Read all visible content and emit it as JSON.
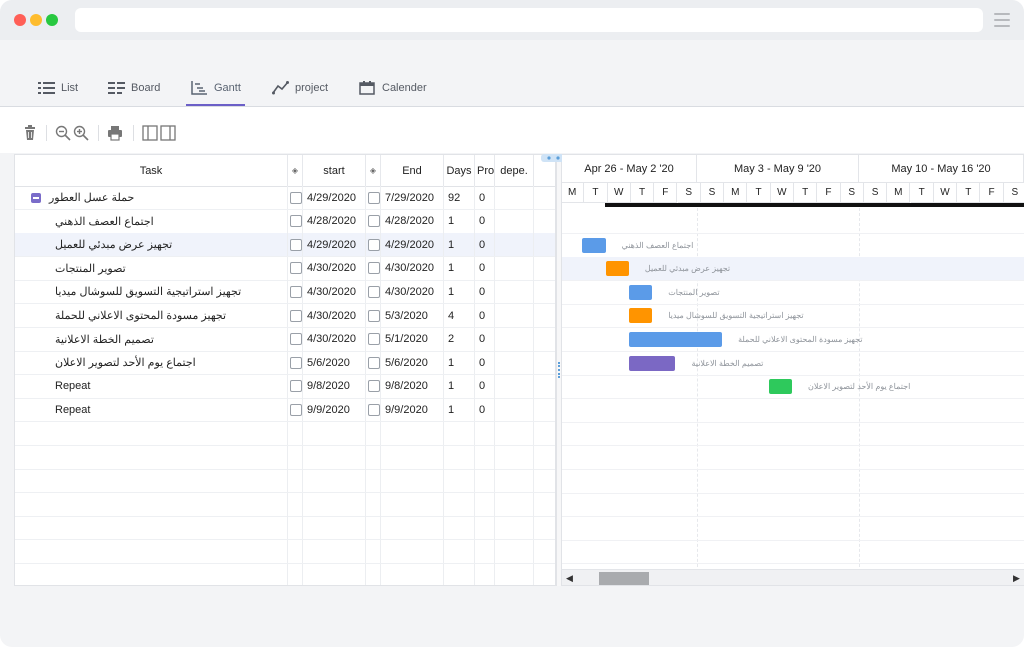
{
  "tabs": [
    {
      "label": "List",
      "icon": "list-icon"
    },
    {
      "label": "Board",
      "icon": "board-icon"
    },
    {
      "label": "Gantt",
      "icon": "gantt-icon",
      "active": true
    },
    {
      "label": "project",
      "icon": "project-icon"
    },
    {
      "label": "Calender",
      "icon": "calendar-icon"
    }
  ],
  "toolbar": [
    "trash-icon",
    "zoom-out-icon",
    "zoom-in-icon",
    "print-icon",
    "panel-left-icon",
    "panel-right-icon"
  ],
  "grid": {
    "columns": {
      "task": "Task",
      "start": "start",
      "end": "End",
      "days": "Days",
      "progress": "Pro",
      "deps": "depe."
    },
    "rows": [
      {
        "task": "حملة عسل العطور",
        "start": "4/29/2020",
        "end": "7/29/2020",
        "days": "92",
        "progress": "0",
        "parent": true
      },
      {
        "task": "اجتماع العصف الذهني",
        "start": "4/28/2020",
        "end": "4/28/2020",
        "days": "1",
        "progress": "0"
      },
      {
        "task": "تجهيز عرض مبدئي للعميل",
        "start": "4/29/2020",
        "end": "4/29/2020",
        "days": "1",
        "progress": "0",
        "selected": true
      },
      {
        "task": "تصوير المنتجات",
        "start": "4/30/2020",
        "end": "4/30/2020",
        "days": "1",
        "progress": "0"
      },
      {
        "task": "تجهيز استراتيجية التسويق للسوشال ميديا",
        "start": "4/30/2020",
        "end": "4/30/2020",
        "days": "1",
        "progress": "0"
      },
      {
        "task": "تجهيز مسودة المحتوى الاعلاني للحملة",
        "start": "4/30/2020",
        "end": "5/3/2020",
        "days": "4",
        "progress": "0"
      },
      {
        "task": "تصميم الخطة الاعلانية",
        "start": "4/30/2020",
        "end": "5/1/2020",
        "days": "2",
        "progress": "0"
      },
      {
        "task": "اجتماع يوم الأحد لتصوير الاعلان",
        "start": "5/6/2020",
        "end": "5/6/2020",
        "days": "1",
        "progress": "0"
      },
      {
        "task": "Repeat",
        "start": "9/8/2020",
        "end": "9/8/2020",
        "days": "1",
        "progress": "0"
      },
      {
        "task": "Repeat",
        "start": "9/9/2020",
        "end": "9/9/2020",
        "days": "1",
        "progress": "0"
      }
    ]
  },
  "timeline": {
    "weeks": [
      "Apr 26 - May 2 '20",
      "May 3 - May 9 '20",
      "May 10 - May 16 '20"
    ],
    "days": [
      "M",
      "T",
      "W",
      "T",
      "F",
      "S",
      "S",
      "M",
      "T",
      "W",
      "T",
      "F",
      "S",
      "S",
      "M",
      "T",
      "W",
      "T",
      "F",
      "S"
    ],
    "bars": [
      {
        "label": "اجتماع العصف الذهني",
        "color": "#5b9be8",
        "day": 1,
        "span": 1
      },
      {
        "label": "تجهيز عرض مبدئي للعميل",
        "color": "#ff9400",
        "day": 2,
        "span": 1
      },
      {
        "label": "تصوير المنتجات",
        "color": "#5b9be8",
        "day": 3,
        "span": 1
      },
      {
        "label": "تجهيز استراتيجية التسويق للسوشال ميديا",
        "color": "#ff9400",
        "day": 3,
        "span": 1
      },
      {
        "label": "تجهيز مسودة المحتوى الاعلاني للحملة",
        "color": "#5b9be8",
        "day": 3,
        "span": 4
      },
      {
        "label": "تصميم الخطة الاعلانية",
        "color": "#7b68c4",
        "day": 3,
        "span": 2
      },
      {
        "label": "اجتماع يوم الأحد لتصوير الاعلان",
        "color": "#2ec95c",
        "day": 9,
        "span": 1
      }
    ],
    "summary_color": "#111111"
  }
}
